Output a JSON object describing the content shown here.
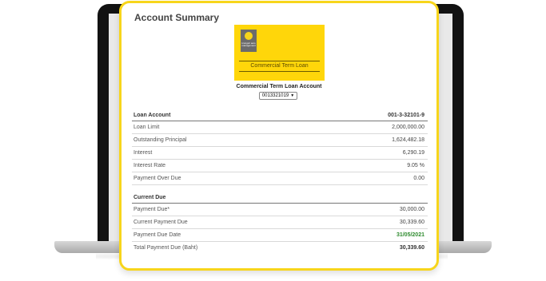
{
  "panel": {
    "title": "Account Summary"
  },
  "card": {
    "logo_text": "krungsri auto management",
    "name": "Commercial Term Loan"
  },
  "account": {
    "label": "Commercial Term Loan Account",
    "selected": "0013321019",
    "dropdown_icon": "triangle-down"
  },
  "loan_account": {
    "header_label": "Loan Account",
    "header_value": "001-3-32101-9",
    "rows": [
      {
        "label": "Loan Limit",
        "value": "2,000,000.00"
      },
      {
        "label": "Outstanding Principal",
        "value": "1,624,482.18"
      },
      {
        "label": "Interest",
        "value": "6,290.19"
      },
      {
        "label": "Interest Rate",
        "value": "9.05 %"
      },
      {
        "label": "Payment Over Due",
        "value": "0.00"
      }
    ]
  },
  "current_due": {
    "header_label": "Current Due",
    "rows": [
      {
        "label": "Payment Due*",
        "value": "30,000.00"
      },
      {
        "label": "Current Payment Due",
        "value": "30,339.60"
      },
      {
        "label": "Payment Due Date",
        "value": "31/05/2021"
      },
      {
        "label": "Total Payment Due (Baht)",
        "value": "30,339.60"
      }
    ]
  },
  "colors": {
    "accent": "#f7d51b",
    "card": "#ffd60a",
    "due_date": "#2e8b2e"
  }
}
